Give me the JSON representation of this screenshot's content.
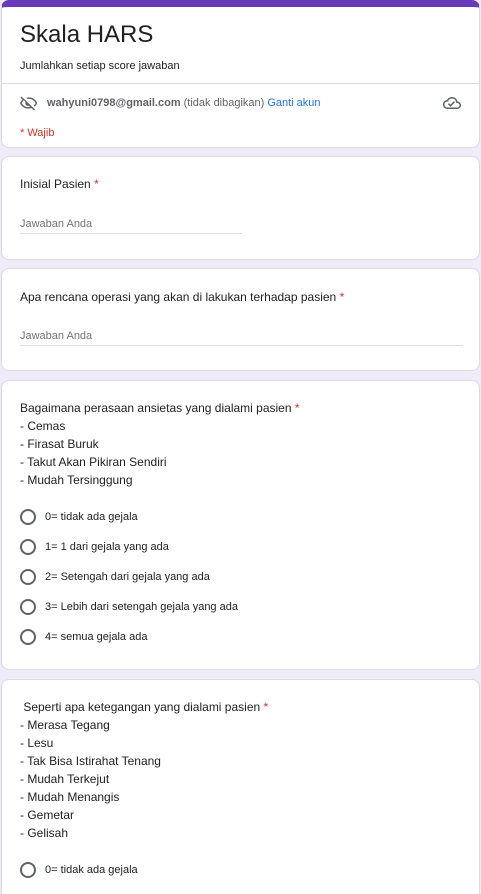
{
  "header": {
    "title": "Skala HARS",
    "description": "Jumlahkan setiap score jawaban",
    "email": "wahyuni0798@gmail.com",
    "not_shared": "(tidak dibagikan)",
    "switch_account": "Ganti akun",
    "required_note": "* Wajib"
  },
  "questions": [
    {
      "title": "Inisial Pasien",
      "required_mark": "*",
      "placeholder": "Jawaban Anda"
    },
    {
      "title": "Apa rencana operasi yang akan di lakukan terhadap pasien",
      "required_mark": "*",
      "placeholder": "Jawaban Anda"
    },
    {
      "title": "Bagaimana perasaan ansietas yang dialami pasien",
      "required_mark": "*",
      "lines": [
        "- Cemas",
        "- Firasat Buruk",
        "- Takut Akan Pikiran Sendiri",
        "- Mudah Tersinggung"
      ],
      "options": [
        "0= tidak ada gejala",
        "1= 1 dari gejala yang ada",
        "2= Setengah dari gejala yang ada",
        "3= Lebih dari setengah gejala yang ada",
        "4= semua gejala ada"
      ]
    },
    {
      "title": " Seperti apa ketegangan yang dialami pasien",
      "required_mark": "*",
      "lines": [
        "- Merasa Tegang",
        "- Lesu",
        "- Tak Bisa Istirahat Tenang",
        "- Mudah Terkejut",
        "- Mudah Menangis",
        "- Gemetar",
        "- Gelisah"
      ],
      "options": [
        "0= tidak ada gejala"
      ]
    }
  ],
  "colors": {
    "accent": "#673ab7",
    "background": "#f0ebf8",
    "required": "#d93025",
    "link": "#1a73e8"
  },
  "icons": {
    "privacy": "eye-off-icon",
    "cloud": "cloud-check-icon"
  }
}
